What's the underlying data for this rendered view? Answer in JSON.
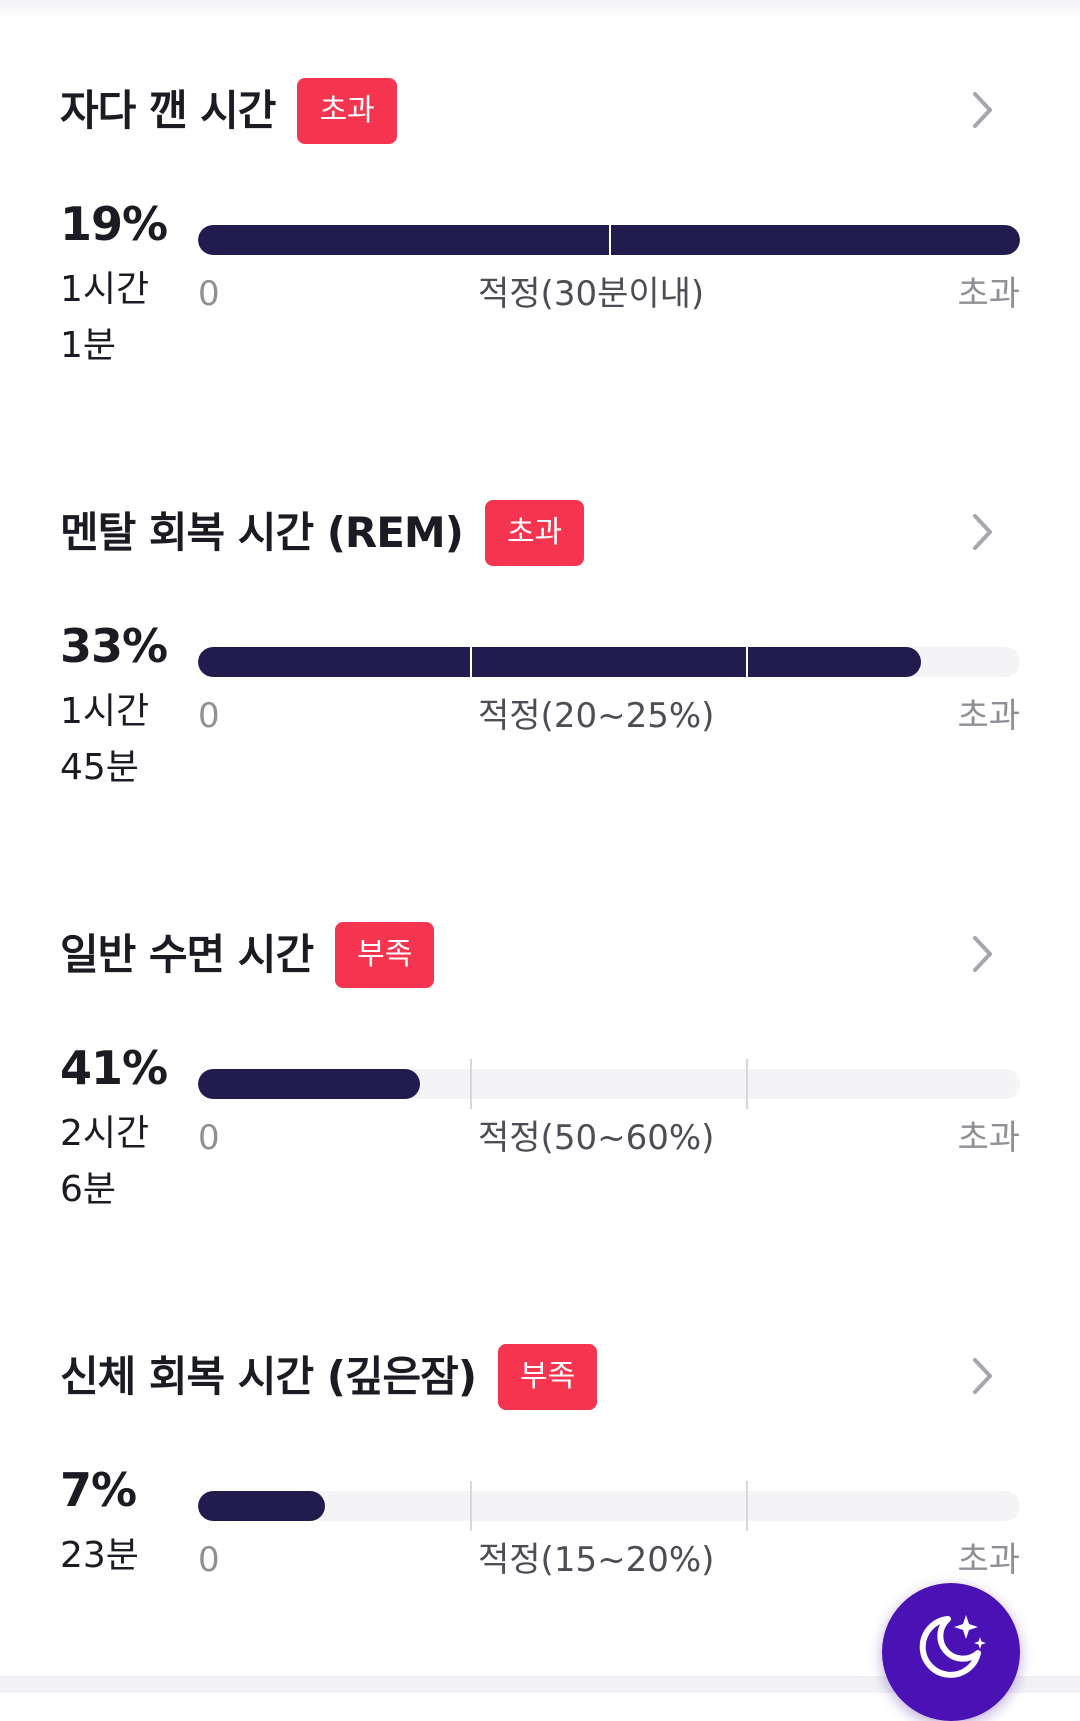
{
  "colors": {
    "badge": "#f5344f",
    "bar_fill": "#221c4e",
    "bar_track": "#f4f4f6",
    "fab": "#4a11b5"
  },
  "axis": {
    "zero_label": "0",
    "max_label": "초과"
  },
  "sections": [
    {
      "title": "자다 깬 시간",
      "badge": "초과",
      "percent": "19%",
      "duration_line1": "1시간",
      "duration_line2": "1분",
      "range_label": "적정(30분이내)",
      "fill_fraction": 1.0
    },
    {
      "title": "멘탈 회복 시간 (REM)",
      "badge": "초과",
      "percent": "33%",
      "duration_line1": "1시간",
      "duration_line2": "45분",
      "range_label": "적정(20~25%)",
      "fill_fraction": 0.88
    },
    {
      "title": "일반 수면 시간",
      "badge": "부족",
      "percent": "41%",
      "duration_line1": "2시간",
      "duration_line2": "6분",
      "range_label": "적정(50~60%)",
      "fill_fraction": 0.27
    },
    {
      "title": "신체 회복 시간 (깊은잠)",
      "badge": "부족",
      "percent": "7%",
      "duration_line1": "23분",
      "duration_line2": "",
      "range_label": "적정(15~20%)",
      "fill_fraction": 0.155
    }
  ],
  "fab_icon": "moon-stars-icon",
  "chevron_icon": "chevron-right-icon"
}
